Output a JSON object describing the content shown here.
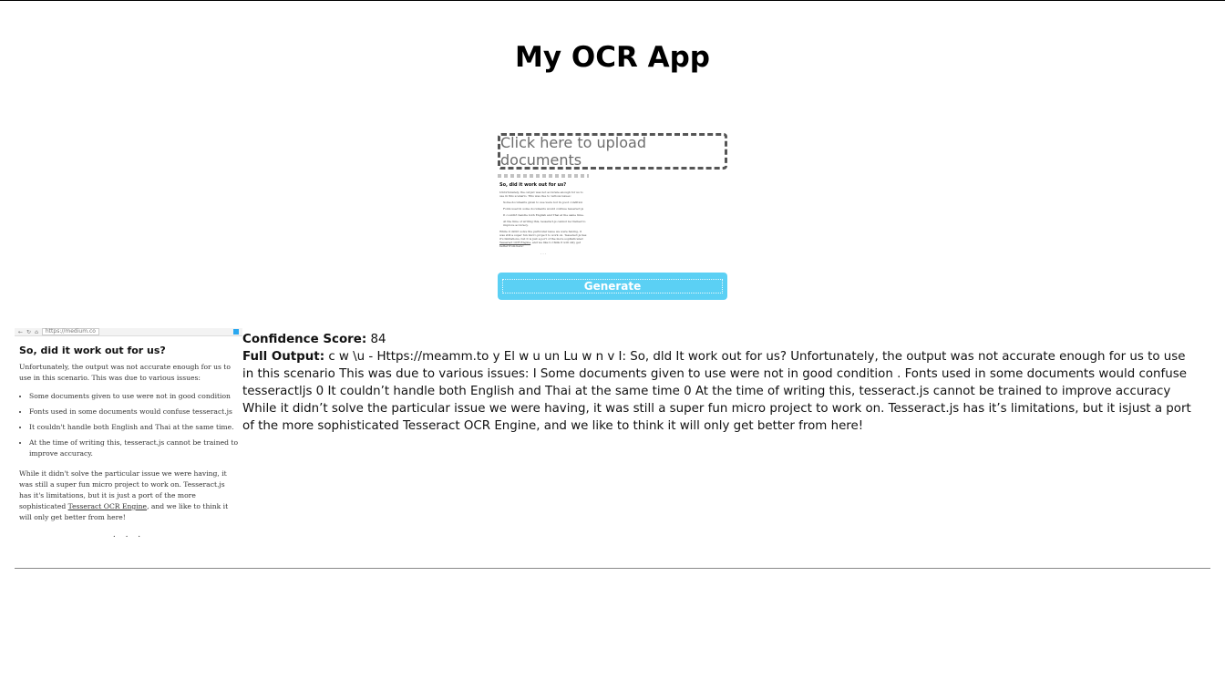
{
  "app": {
    "title": "My OCR App"
  },
  "upload": {
    "label": "Click here to upload documents"
  },
  "thumbnail": {
    "heading": "So, did it work out for us?",
    "intro": "Unfortunately, the output was not accurate enough for us to use in this scenario. This was due to various issues:",
    "bullets": [
      "Some documents given to use were not in good condition",
      "Fonts used in some documents would confuse tesseract.js",
      "It couldn't handle both English and Thai at the same time.",
      "At the time of writing this, tesseract.js cannot be trained to improve accuracy."
    ],
    "closing_text": "While it didn't solve the particular issue we were having, it was still a super fun micro project to work on. Tesseract.js has it's limitations, but it is just a port of the more sophisticated",
    "closing_link": "Tesseract OCR Engine",
    "closing_end": ", and we like to think it will only get better from here!",
    "dots": ". . ."
  },
  "generate": {
    "label": "Generate"
  },
  "document": {
    "url": "https://medium.co",
    "heading": "So, did it work out for us?",
    "intro": "Unfortunately, the output was not accurate enough for us to use in this scenario. This was due to various issues:",
    "bullets": [
      "Some documents given to use were not in good condition",
      "Fonts used in some documents would confuse tesseract.js",
      "It couldn't handle both English and Thai at the same time.",
      "At the time of writing this, tesseract.js cannot be trained to improve accuracy."
    ],
    "closing_text": "While it didn't solve the particular issue we were having, it was still a super fun micro project to work on. Tesseract.js has it's limitations, but it is just a port of the more sophisticated ",
    "closing_link": "Tesseract OCR Engine",
    "closing_end": ", and we like to think it will only get better from here!",
    "dots": ". . ."
  },
  "result": {
    "confidence_label": "Confidence Score:",
    "confidence_value": "84",
    "output_label": "Full Output:",
    "output_text": "c w \\u - Https://meamm.to y El w u un Lu w n v I: So, dld It work out for us? Unfortunately, the output was not accurate enough for us to use in this scenario This was due to various issues: I Some documents given to use were not in good condition . Fonts used in some documents would confuse tesseractljs 0 It couldn’t handle both English and Thai at the same time 0 At the time of writing this, tesseract.js cannot be trained to improve accuracy While it didn’t solve the particular issue we were having, it was still a super fun micro project to work on. Tesseract.js has it’s limitations, but it isjust a port of the more sophisticated Tesseract OCR Engine, and we like to think it will only get better from here!"
  },
  "colors": {
    "generate_button": "#5bd0f4",
    "upload_border": "#555555",
    "divider": "#888888"
  }
}
